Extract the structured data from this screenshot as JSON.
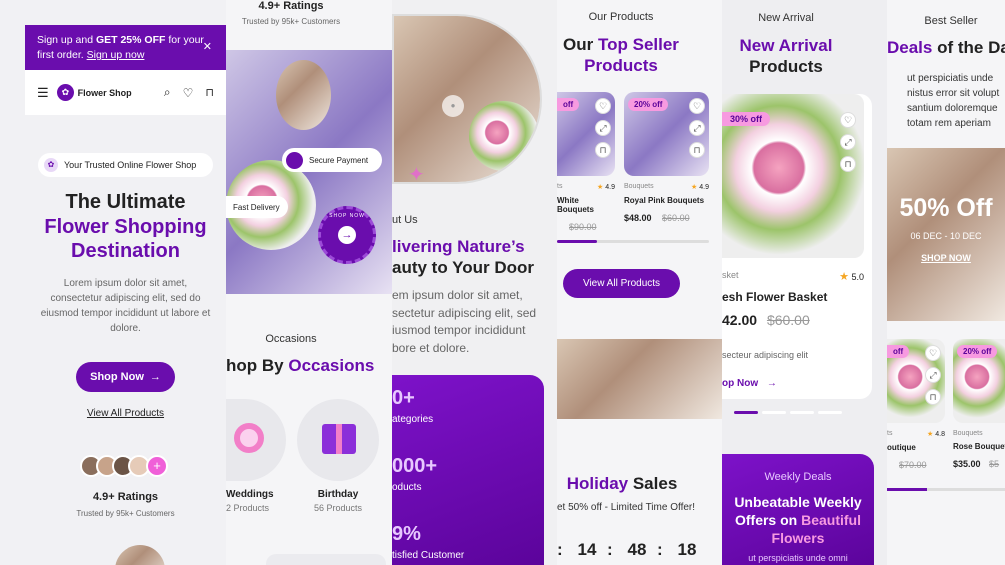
{
  "col1": {
    "promo": {
      "text1": "Sign up and ",
      "bold": "GET 25% OFF",
      "text2": " for your first order.",
      "link": "Sign up now"
    },
    "brand": "Flower Shop",
    "trusted_tag": "Your Trusted Online Flower Shop",
    "hero_line1": "The Ultimate",
    "hero_line2": "Flower Shopping",
    "hero_line3": "Destination",
    "hero_body": "Lorem ipsum dolor sit amet, consectetur adipiscing elit, sed do eiusmod tempor incididunt ut labore et dolore.",
    "shop_now": "Shop Now",
    "view_all": "View All Products",
    "rating": "4.9+ Ratings",
    "trusted_by": "Trusted by 95k+ Customers"
  },
  "col2": {
    "rating": "4.9+ Ratings",
    "trusted_by": "Trusted by 95k+ Customers",
    "secure_payment": "Secure Payment",
    "fast_delivery": "Fast Delivery",
    "stamp_text": "SHOP NOW",
    "occasions_label": "Occasions",
    "occasions_title_a": "hop By ",
    "occasions_title_b": "Occasions",
    "occasions": [
      {
        "name": "Weddings",
        "count": "2 Products"
      },
      {
        "name": "Birthday",
        "count": "56 Products"
      }
    ]
  },
  "col3": {
    "about_label": "ut Us",
    "title_a": "livering Nature’s",
    "title_b": "auty to Your Door",
    "body": "em ipsum dolor sit amet, sectetur adipiscing elit, sed iusmod tempor incididunt bore et dolore.",
    "stats": [
      {
        "value": "0+",
        "label": "ategories"
      },
      {
        "value": "000+",
        "label": "oducts"
      },
      {
        "value": "9%",
        "label": "tisfied Customer"
      }
    ]
  },
  "col4": {
    "label": "Our Products",
    "title_a": "Our ",
    "title_b": "Top Seller",
    "title_c": "Products",
    "products": [
      {
        "badge": "off",
        "cat": "ts",
        "rating": "4.9",
        "name": "White Bouquets",
        "price": "",
        "old": "$90.00"
      },
      {
        "badge": "20% off",
        "cat": "Bouquets",
        "rating": "4.9",
        "name": "Royal Pink Bouquets",
        "price": "$48.00",
        "old": "$60.00"
      }
    ],
    "view_all": "View All Products",
    "holiday_a": "Holiday",
    "holiday_b": " Sales",
    "holiday_sub": "et 50% off - Limited Time Offer!",
    "countdown": [
      "14",
      "48",
      "18"
    ]
  },
  "col5": {
    "label": "New Arrival",
    "title_a": "New Arrival",
    "title_b": "Products",
    "badge": "30% off",
    "cat": "sket",
    "rating": "5.0",
    "name": "esh Flower Basket",
    "price": "42.00",
    "old": "$60.00",
    "desc": "secteur adipiscing elit",
    "shop_now": "op Now",
    "weekly_label": "Weekly Deals",
    "weekly_a": "Unbeatable Weekly",
    "weekly_b": "Offers on ",
    "weekly_c": "Beautiful",
    "weekly_d": "Flowers",
    "weekly_body": "ut perspiciatis unde omni"
  },
  "col6": {
    "label": "Best Seller",
    "title_a": "Deals",
    "title_b": " of the Da",
    "body": "ut perspiciatis unde nistus error sit volupt santium doloremque totam rem aperiam",
    "sale": "50% Off",
    "dates": "06 DEC - 10 DEC",
    "shop_now": "SHOP NOW",
    "products": [
      {
        "badge": "off",
        "cat": "ts",
        "rating": "4.8",
        "name": "outique",
        "price": "",
        "old": "$70.00"
      },
      {
        "badge": "20% off",
        "cat": "Bouquets",
        "rating": "",
        "name": "Rose Bouquets",
        "price": "$35.00",
        "old": "$5"
      }
    ]
  }
}
